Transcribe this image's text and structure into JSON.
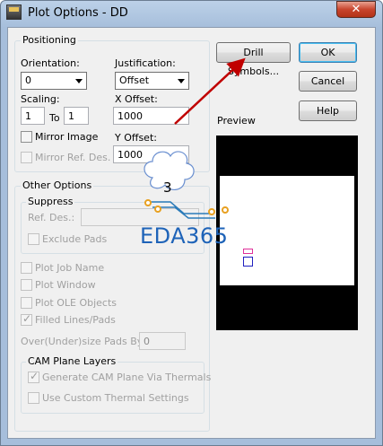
{
  "window": {
    "title": "Plot Options - DD",
    "close_label": "✕"
  },
  "positioning": {
    "group_label": "Positioning",
    "orientation_label": "Orientation:",
    "orientation_value": "0",
    "justification_label": "Justification:",
    "justification_value": "Offset",
    "scaling_label": "Scaling:",
    "scaling_from": "1",
    "scaling_to_label": "To",
    "scaling_to": "1",
    "x_offset_label": "X Offset:",
    "x_offset_value": "1000",
    "y_offset_label": "Y Offset:",
    "y_offset_value": "1000",
    "mirror_image_label": "Mirror Image",
    "mirror_ref_label": "Mirror Ref. Des."
  },
  "buttons": {
    "drill_symbols": "Drill Symbols...",
    "ok": "OK",
    "cancel": "Cancel",
    "help": "Help"
  },
  "preview": {
    "label": "Preview"
  },
  "other_options": {
    "group_label": "Other Options",
    "suppress_label": "Suppress",
    "ref_des_label": "Ref. Des.:",
    "exclude_pads_label": "Exclude Pads",
    "plot_job_name": "Plot Job Name",
    "plot_window": "Plot Window",
    "plot_ole_objects": "Plot OLE Objects",
    "filled_lines_pads": "Filled Lines/Pads",
    "over_under_label": "Over(Under)size Pads By:",
    "over_under_value": "0",
    "cam_plane_label": "CAM Plane Layers",
    "generate_cam_plane": "Generate CAM Plane Via Thermals",
    "use_custom_thermal": "Use Custom Thermal Settings"
  },
  "annotation": {
    "cloud_number": "3",
    "watermark": "EDA365"
  },
  "colors": {
    "arrow": "#c00000",
    "watermark": "#1e63b8",
    "circuit": "#e8a020"
  }
}
